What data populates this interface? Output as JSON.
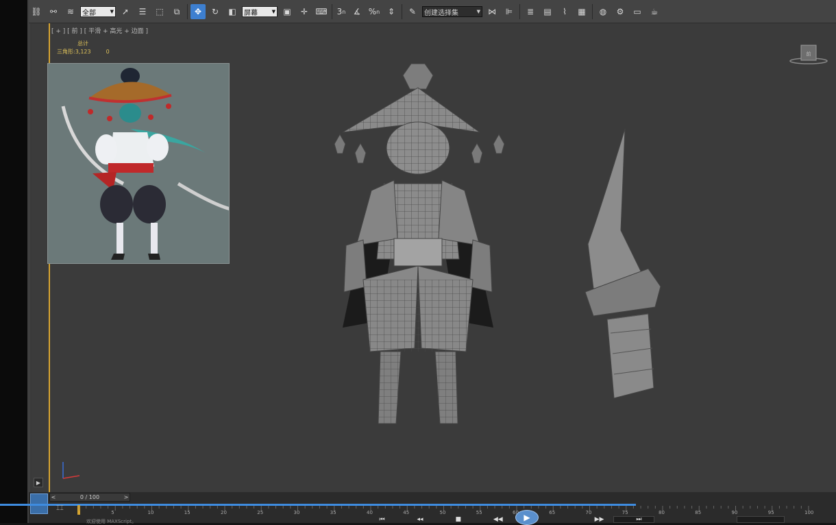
{
  "toolbar": {
    "selection_filter": "全部",
    "reference_coord": "屏幕",
    "named_selection": "创建选择集",
    "snap_3": "3",
    "snap_percent": "%",
    "icons": [
      "link-icon",
      "unlink-icon",
      "bind-spacewarp-icon",
      "select-icon",
      "select-by-name-icon",
      "rect-region-icon",
      "window-crossing-icon",
      "move-icon",
      "rotate-icon",
      "use-pivot-icon",
      "manipulate-icon",
      "keyboard-shortcut-icon",
      "snap-icon",
      "angle-snap-icon",
      "percent-snap-icon",
      "spinner-snap-icon",
      "edit-named-sets-icon",
      "mirror-icon",
      "align-icon",
      "layer-manager-icon",
      "curve-editor-icon",
      "schematic-view-icon",
      "material-editor-icon",
      "render-setup-icon",
      "rendered-frame-icon",
      "render-icon"
    ]
  },
  "viewport": {
    "label": "[ + ] [ 前 ] [ 平滑 + 高光 + 边面 ]",
    "stats_title": "总计",
    "stats_label": "三角形:",
    "stats_value": "3,123",
    "stats_value2": "0"
  },
  "timeline": {
    "frame_display": "0 / 100",
    "prev_arrow": "<",
    "next_arrow": ">",
    "ticks": [
      "5",
      "10",
      "15",
      "20",
      "25",
      "30",
      "35",
      "40",
      "45",
      "50",
      "55",
      "60",
      "65",
      "70",
      "75",
      "80",
      "85",
      "90",
      "95",
      "100"
    ],
    "status_text": "欢迎使用 MAXScript。"
  }
}
